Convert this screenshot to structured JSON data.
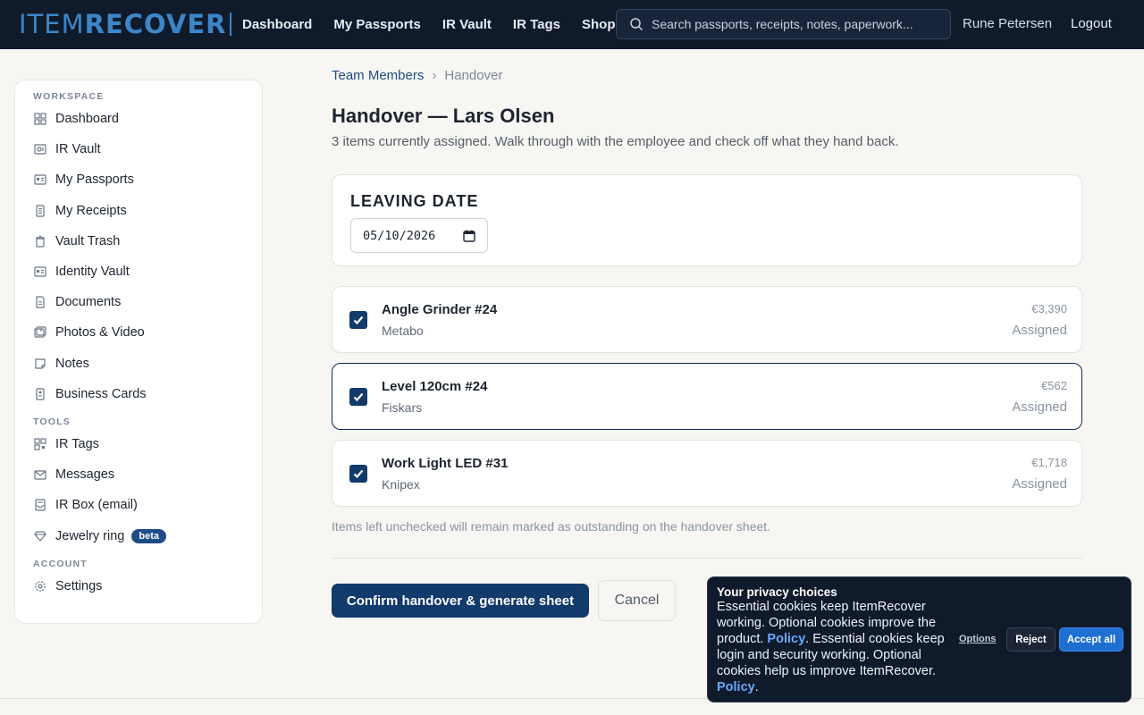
{
  "brand": {
    "part1": "ITEM",
    "part2": "RECOVER"
  },
  "nav": {
    "links": [
      "Dashboard",
      "My Passports",
      "IR Vault",
      "IR Tags",
      "Shop"
    ],
    "search_placeholder": "Search passports, receipts, notes, paperwork...",
    "user": "Rune Petersen",
    "logout": "Logout"
  },
  "sidebar": {
    "workspace_label": "WORKSPACE",
    "tools_label": "TOOLS",
    "account_label": "ACCOUNT",
    "workspace": [
      {
        "label": "Dashboard",
        "icon": "grid-icon"
      },
      {
        "label": "IR Vault",
        "icon": "vault-icon"
      },
      {
        "label": "My Passports",
        "icon": "passport-icon"
      },
      {
        "label": "My Receipts",
        "icon": "receipt-icon"
      },
      {
        "label": "Vault Trash",
        "icon": "trash-icon"
      },
      {
        "label": "Identity Vault",
        "icon": "id-card-icon"
      },
      {
        "label": "Documents",
        "icon": "document-icon"
      },
      {
        "label": "Photos & Video",
        "icon": "photos-icon"
      },
      {
        "label": "Notes",
        "icon": "note-icon"
      },
      {
        "label": "Business Cards",
        "icon": "business-card-icon"
      }
    ],
    "tools": [
      {
        "label": "IR Tags",
        "icon": "qr-icon"
      },
      {
        "label": "Messages",
        "icon": "mail-icon"
      },
      {
        "label": "IR Box (email)",
        "icon": "inbox-icon"
      },
      {
        "label": "Jewelry ring",
        "icon": "diamond-icon",
        "badge": "beta"
      }
    ],
    "account": [
      {
        "label": "Settings",
        "icon": "gear-icon"
      }
    ]
  },
  "breadcrumb": {
    "parent": "Team Members",
    "current": "Handover"
  },
  "page": {
    "title": "Handover — Lars Olsen",
    "subtitle": "3 items currently assigned. Walk through with the employee and check off what they hand back."
  },
  "leaving_date": {
    "label": "LEAVING DATE",
    "value": "2026-05-10",
    "display": "05/10/2026"
  },
  "items": [
    {
      "name": "Angle Grinder #24",
      "brand": "Metabo",
      "price": "€3,390",
      "status": "Assigned",
      "checked": true
    },
    {
      "name": "Level 120cm #24",
      "brand": "Fiskars",
      "price": "€562",
      "status": "Assigned",
      "checked": true
    },
    {
      "name": "Work Light LED #31",
      "brand": "Knipex",
      "price": "€1,718",
      "status": "Assigned",
      "checked": true
    }
  ],
  "note": "Items left unchecked will remain marked as outstanding on the handover sheet.",
  "actions": {
    "confirm": "Confirm handover & generate sheet",
    "cancel": "Cancel"
  },
  "cookie": {
    "title": "Your privacy choices",
    "text1": "Essential cookies keep ItemRecover working. Optional cookies improve the product. ",
    "policy": "Policy",
    "text2": ". Essential cookies keep login and security working. Optional cookies help us improve ItemRecover. ",
    "text3": ".",
    "options": "Options",
    "reject": "Reject",
    "accept": "Accept all"
  },
  "colors": {
    "nav_bg": "#0f1a2b",
    "accent": "#123a6b",
    "link": "#1e4c86",
    "accept": "#1f6fd1"
  }
}
